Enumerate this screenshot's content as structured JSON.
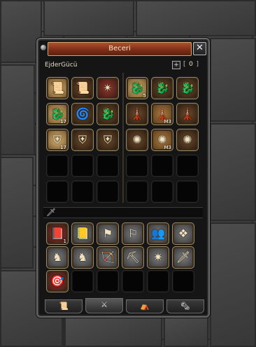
{
  "window": {
    "title": "Beceri",
    "close_label": "✕"
  },
  "category": {
    "name": "EjderGücü",
    "plus_label": "+",
    "points": "0"
  },
  "skill_grid": [
    {
      "icon": "scroll-icon",
      "cls": "active",
      "lvl": ""
    },
    {
      "icon": "scroll-icon",
      "cls": "dark",
      "lvl": ""
    },
    {
      "icon": "rune-icon",
      "cls": "red",
      "lvl": ""
    },
    {
      "icon": "dragon-icon",
      "cls": "active",
      "lvl": "5"
    },
    {
      "icon": "dragon-icon",
      "cls": "dark",
      "lvl": ""
    },
    {
      "icon": "dragon-icon",
      "cls": "dark",
      "lvl": ""
    },
    {
      "icon": "dragon-icon",
      "cls": "active",
      "lvl": "17"
    },
    {
      "icon": "swirl-icon",
      "cls": "dark",
      "lvl": ""
    },
    {
      "icon": "dragon-icon",
      "cls": "dark",
      "lvl": ""
    },
    {
      "icon": "tower-icon",
      "cls": "dark",
      "lvl": ""
    },
    {
      "icon": "tower-icon",
      "cls": "brown",
      "lvl": "M3"
    },
    {
      "icon": "tower-icon",
      "cls": "dark",
      "lvl": ""
    },
    {
      "icon": "shield-icon",
      "cls": "active",
      "lvl": "17"
    },
    {
      "icon": "shield-icon",
      "cls": "dark",
      "lvl": ""
    },
    {
      "icon": "shield-icon",
      "cls": "dark",
      "lvl": ""
    },
    {
      "icon": "spiral-icon",
      "cls": "dark",
      "lvl": ""
    },
    {
      "icon": "spiral-icon",
      "cls": "brown",
      "lvl": "M3"
    },
    {
      "icon": "spiral-icon",
      "cls": "dark",
      "lvl": ""
    },
    {
      "icon": "",
      "cls": "",
      "lvl": ""
    },
    {
      "icon": "",
      "cls": "",
      "lvl": ""
    },
    {
      "icon": "",
      "cls": "",
      "lvl": ""
    },
    {
      "icon": "",
      "cls": "",
      "lvl": ""
    },
    {
      "icon": "",
      "cls": "",
      "lvl": ""
    },
    {
      "icon": "",
      "cls": "",
      "lvl": ""
    },
    {
      "icon": "",
      "cls": "",
      "lvl": ""
    },
    {
      "icon": "",
      "cls": "",
      "lvl": ""
    },
    {
      "icon": "",
      "cls": "",
      "lvl": ""
    },
    {
      "icon": "",
      "cls": "",
      "lvl": ""
    },
    {
      "icon": "",
      "cls": "",
      "lvl": ""
    },
    {
      "icon": "",
      "cls": "",
      "lvl": ""
    }
  ],
  "support_grid": [
    {
      "icon": "red-book-icon",
      "cls": "red",
      "lvl": "1"
    },
    {
      "icon": "yellow-book-icon",
      "cls": "gray",
      "lvl": ""
    },
    {
      "icon": "flag-icon",
      "cls": "gray",
      "lvl": ""
    },
    {
      "icon": "flag-up-icon",
      "cls": "gray",
      "lvl": ""
    },
    {
      "icon": "group-icon",
      "cls": "gray",
      "lvl": ""
    },
    {
      "icon": "knot-icon",
      "cls": "gray",
      "lvl": ""
    },
    {
      "icon": "horse-icon",
      "cls": "gray",
      "lvl": ""
    },
    {
      "icon": "horse-icon",
      "cls": "gray",
      "lvl": ""
    },
    {
      "icon": "bow-icon",
      "cls": "gray",
      "lvl": ""
    },
    {
      "icon": "pickaxe-icon",
      "cls": "gray",
      "lvl": ""
    },
    {
      "icon": "claw-icon",
      "cls": "gray",
      "lvl": ""
    },
    {
      "icon": "sword-icon",
      "cls": "gray",
      "lvl": ""
    },
    {
      "icon": "target-icon",
      "cls": "red",
      "lvl": ""
    },
    {
      "icon": "",
      "cls": "",
      "lvl": ""
    },
    {
      "icon": "",
      "cls": "",
      "lvl": ""
    },
    {
      "icon": "",
      "cls": "",
      "lvl": ""
    },
    {
      "icon": "",
      "cls": "",
      "lvl": ""
    },
    {
      "icon": "",
      "cls": "",
      "lvl": ""
    }
  ],
  "tabs": [
    {
      "icon": "book-tab-icon"
    },
    {
      "icon": "sword-tab-icon"
    },
    {
      "icon": "camp-tab-icon"
    },
    {
      "icon": "scroll-tab-icon"
    }
  ]
}
